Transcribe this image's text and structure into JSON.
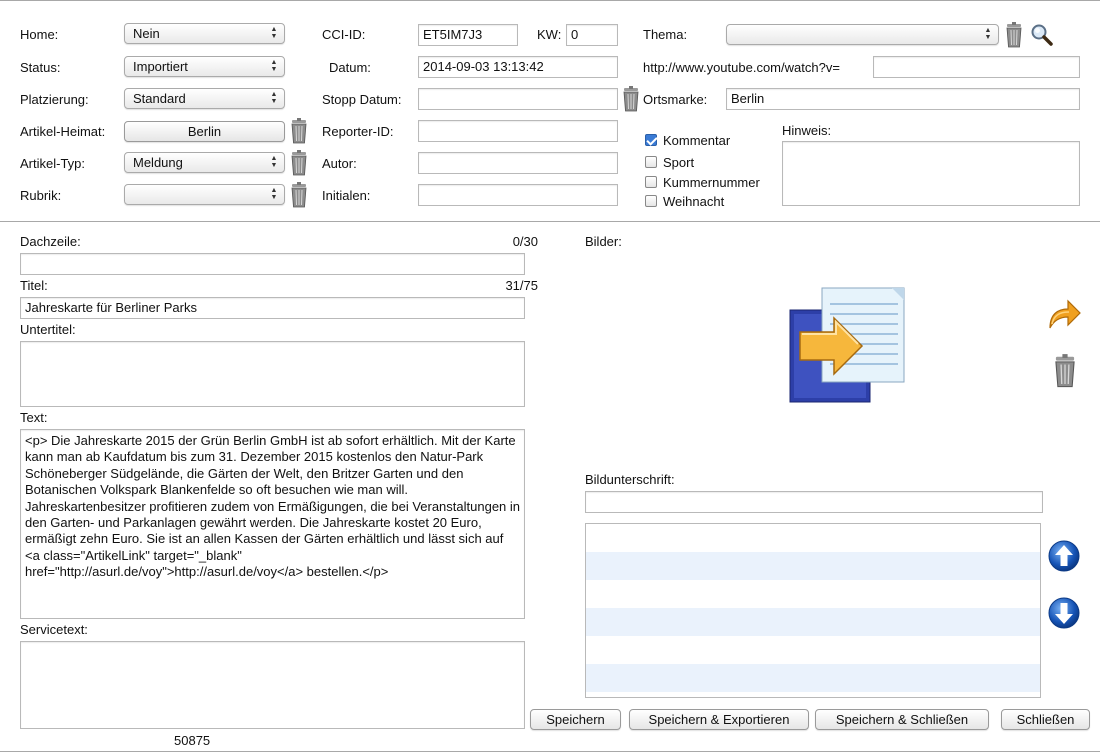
{
  "top": {
    "home": {
      "label": "Home:",
      "value": "Nein"
    },
    "status": {
      "label": "Status:",
      "value": "Importiert"
    },
    "platzierung": {
      "label": "Platzierung:",
      "value": "Standard"
    },
    "artikel_heimat": {
      "label": "Artikel-Heimat:",
      "value": "Berlin"
    },
    "artikel_typ": {
      "label": "Artikel-Typ:",
      "value": "Meldung"
    },
    "rubrik": {
      "label": "Rubrik:",
      "value": ""
    },
    "cci_id": {
      "label": "CCI-ID:",
      "value": "ET5IM7J3"
    },
    "kw": {
      "label": "KW:",
      "value": "0"
    },
    "datum": {
      "label": "Datum:",
      "value": "2014-09-03 13:13:42"
    },
    "stopp_datum": {
      "label": "Stopp Datum:",
      "value": ""
    },
    "reporter_id": {
      "label": "Reporter-ID:",
      "value": ""
    },
    "autor": {
      "label": "Autor:",
      "value": ""
    },
    "initialen": {
      "label": "Initialen:",
      "value": ""
    },
    "thema": {
      "label": "Thema:",
      "value": ""
    },
    "youtube": {
      "label": "http://www.youtube.com/watch?v=",
      "value": ""
    },
    "ortsmarke": {
      "label": "Ortsmarke:",
      "value": "Berlin"
    },
    "checkboxes": [
      {
        "label": "Kommentar",
        "checked": true
      },
      {
        "label": "Sport",
        "checked": false
      },
      {
        "label": "Kummernummer",
        "checked": false
      },
      {
        "label": "Weihnacht",
        "checked": false
      }
    ],
    "hinweis": {
      "label": "Hinweis:",
      "value": ""
    }
  },
  "article": {
    "dachzeile": {
      "label": "Dachzeile:",
      "counter": "0/30",
      "value": ""
    },
    "titel": {
      "label": "Titel:",
      "counter": "31/75",
      "value": "Jahreskarte für Berliner Parks"
    },
    "untertitel": {
      "label": "Untertitel:",
      "value": ""
    },
    "text": {
      "label": "Text:",
      "value": "<p> Die Jahreskarte 2015 der Grün Berlin GmbH ist ab sofort erhältlich. Mit der Karte kann man ab Kaufdatum bis zum 31. Dezember 2015 kostenlos den Natur-Park Schöneberger Südgelände, die Gärten der Welt, den Britzer Garten und den Botanischen Volkspark Blankenfelde so oft besuchen wie man will. Jahreskartenbesitzer profitieren zudem von Ermäßigungen, die bei Veranstaltungen in den Garten- und Parkanlagen gewährt werden. Die Jahreskarte kostet 20 Euro, ermäßigt zehn Euro. Sie ist an allen Kassen der Gärten erhältlich und lässt sich auf <a class=\"ArtikelLink\" target=\"_blank\" href=\"http://asurl.de/voy\">http://asurl.de/voy</a> bestellen.</p>"
    },
    "servicetext": {
      "label": "Servicetext:",
      "value": ""
    },
    "footer_number": "50875"
  },
  "images": {
    "label": "Bilder:",
    "bildunterschrift": {
      "label": "Bildunterschrift:",
      "value": ""
    }
  },
  "buttons": {
    "speichern": "Speichern",
    "speichern_exportieren": "Speichern & Exportieren",
    "speichern_schliessen": "Speichern & Schließen",
    "schliessen": "Schließen"
  },
  "icons": {
    "trash": "trash-icon",
    "search": "magnifier-icon",
    "import": "copy-arrow-icon",
    "forward": "forward-arrow-icon",
    "up": "arrow-up-icon",
    "down": "arrow-down-icon"
  },
  "colors": {
    "list_alt_row": "#eaf2fc",
    "accent_blue": "#1553b5",
    "forward_orange": "#f0a020"
  }
}
